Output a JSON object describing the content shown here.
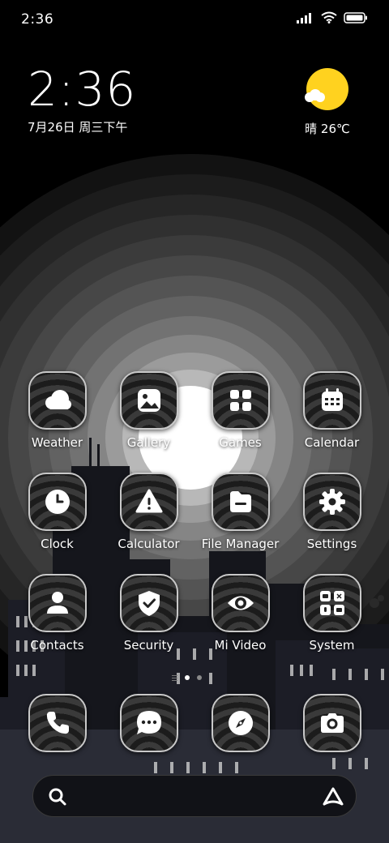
{
  "status_bar": {
    "time": "2:36",
    "signal_icon": "signal-icon",
    "wifi_icon": "wifi-icon",
    "battery_icon": "battery-icon"
  },
  "clock_widget": {
    "time": "2:36",
    "date": "7月26日 周三下午"
  },
  "weather_widget": {
    "condition_icon": "sunny-partly-cloudy-icon",
    "text": "晴 26℃",
    "sun_color": "#ffd21f"
  },
  "apps": [
    {
      "label": "Weather",
      "icon": "weather-cloud-icon"
    },
    {
      "label": "Gallery",
      "icon": "gallery-icon"
    },
    {
      "label": "Games",
      "icon": "games-grid-icon"
    },
    {
      "label": "Calendar",
      "icon": "calendar-icon"
    },
    {
      "label": "Clock",
      "icon": "clock-icon"
    },
    {
      "label": "Calculator",
      "icon": "warning-triangle-icon"
    },
    {
      "label": "File Manager",
      "icon": "folder-icon"
    },
    {
      "label": "Settings",
      "icon": "gear-icon"
    },
    {
      "label": "Contacts",
      "icon": "person-icon"
    },
    {
      "label": "Security",
      "icon": "shield-check-icon"
    },
    {
      "label": "Mi Video",
      "icon": "eye-icon"
    },
    {
      "label": "System",
      "icon": "folder-grid-icon"
    }
  ],
  "page_indicator": {
    "pages": 2,
    "current": 1
  },
  "dock": [
    {
      "icon": "phone-icon"
    },
    {
      "icon": "messages-icon"
    },
    {
      "icon": "compass-icon"
    },
    {
      "icon": "camera-icon"
    }
  ],
  "search_bar": {
    "left_icon": "search-icon",
    "right_icon": "assistant-icon"
  }
}
